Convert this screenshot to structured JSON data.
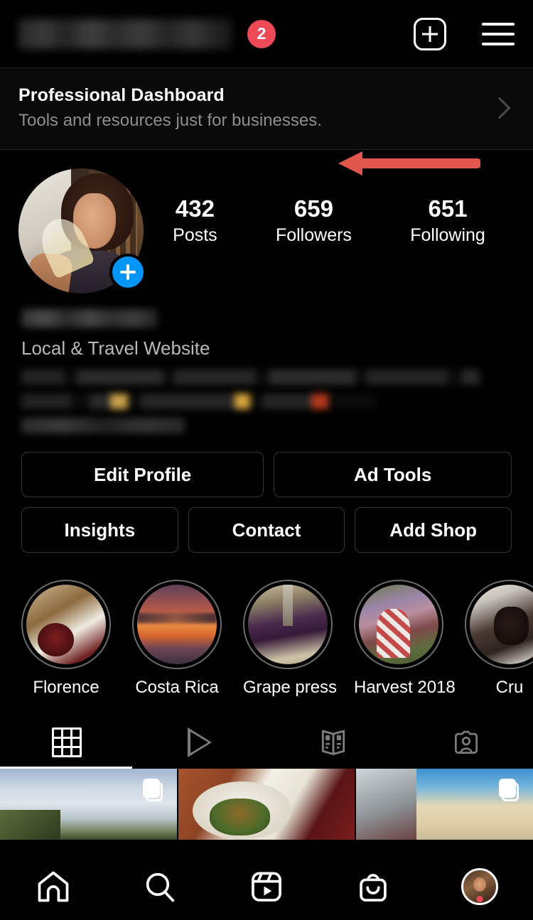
{
  "topbar": {
    "username_redacted": true,
    "notification_badge": "2",
    "new_post_icon": "plus-square-icon",
    "menu_icon": "hamburger-menu-icon"
  },
  "professional_dashboard": {
    "title": "Professional Dashboard",
    "subtitle": "Tools and resources just for businesses.",
    "chevron_icon": "chevron-right-icon",
    "annotation": {
      "type": "arrow",
      "direction": "left",
      "color": "#E2574C"
    }
  },
  "profile": {
    "avatar_alt": "woman-tasting-white-wine",
    "add_story_icon": "plus-badge-icon",
    "add_story_color": "#0095F6",
    "stats": [
      {
        "value": "432",
        "label": "Posts"
      },
      {
        "value": "659",
        "label": "Followers"
      },
      {
        "value": "651",
        "label": "Following"
      }
    ],
    "display_name_redacted": true,
    "category": "Local & Travel Website",
    "bio_redacted": true,
    "link_redacted": true
  },
  "action_buttons": {
    "row1": [
      "Edit Profile",
      "Ad Tools"
    ],
    "row2": [
      "Insights",
      "Contact",
      "Add Shop"
    ]
  },
  "highlights": [
    {
      "label": "Florence",
      "image_alt": "food-plates-and-red-wine"
    },
    {
      "label": "Costa Rica",
      "image_alt": "ocean-sunset"
    },
    {
      "label": "Grape press",
      "image_alt": "grape-press-with-crushed-grapes"
    },
    {
      "label": "Harvest 2018",
      "image_alt": "people-picking-grapes-in-vineyard"
    },
    {
      "label": "Cru",
      "image_alt": "grape-destemmer-machine"
    }
  ],
  "tabs": [
    {
      "name": "grid",
      "icon": "grid-icon",
      "active": true
    },
    {
      "name": "reels",
      "icon": "play-icon",
      "active": false
    },
    {
      "name": "guides",
      "icon": "guides-book-icon",
      "active": false
    },
    {
      "name": "tagged",
      "icon": "tagged-person-icon",
      "active": false
    }
  ],
  "post_grid": [
    {
      "alt": "vineyard-hillside-with-clouds",
      "carousel": true
    },
    {
      "alt": "plated-food-with-red-wine-glass",
      "carousel": false
    },
    {
      "alt": "beach-with-umbrellas",
      "carousel": true
    }
  ],
  "bottom_nav": [
    {
      "name": "home",
      "icon": "home-icon",
      "active": false
    },
    {
      "name": "search",
      "icon": "search-icon",
      "active": false
    },
    {
      "name": "reels",
      "icon": "reels-icon",
      "active": false
    },
    {
      "name": "shop",
      "icon": "shop-bag-icon",
      "active": false
    },
    {
      "name": "profile",
      "icon": "avatar-icon",
      "active": true
    }
  ],
  "colors": {
    "background": "#000000",
    "accent_blue": "#0095F6",
    "badge_red": "#ED4956",
    "annotation_red": "#E2574C",
    "muted_text": "#8e8e8e",
    "border": "#363636"
  }
}
